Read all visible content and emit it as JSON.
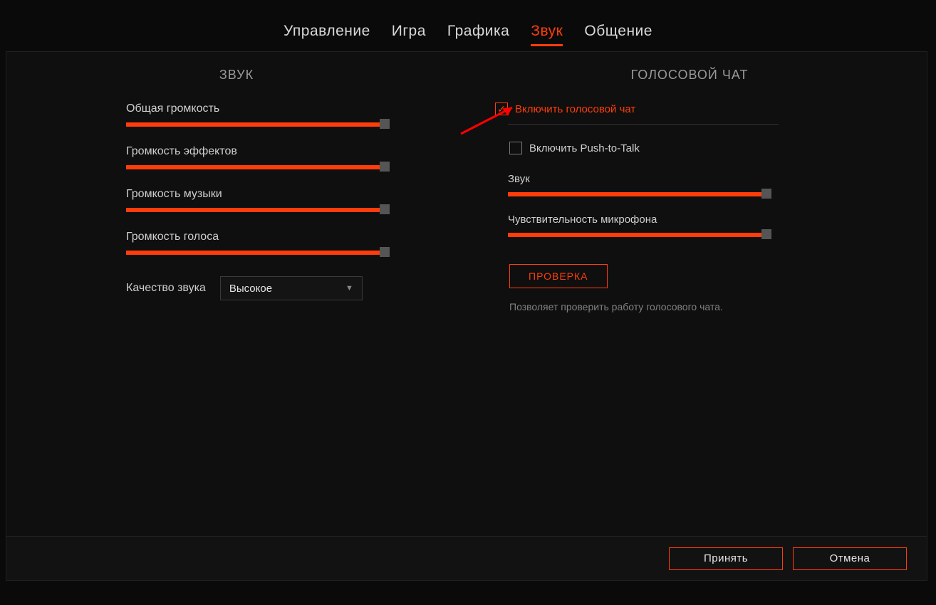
{
  "tabs": {
    "control": "Управление",
    "game": "Игра",
    "graphics": "Графика",
    "sound": "Звук",
    "communication": "Общение"
  },
  "left": {
    "title": "ЗВУК",
    "sliders": {
      "master": {
        "label": "Общая громкость",
        "value": 98
      },
      "effects": {
        "label": "Громкость эффектов",
        "value": 98
      },
      "music": {
        "label": "Громкость музыки",
        "value": 98
      },
      "voice": {
        "label": "Громкость голоса",
        "value": 98
      }
    },
    "quality_label": "Качество звука",
    "quality_value": "Высокое"
  },
  "right": {
    "title": "ГОЛОСОВОЙ ЧАТ",
    "enable_label": "Включить голосовой чат",
    "ptt_label": "Включить Push-tо-Talk",
    "sliders": {
      "sound": {
        "label": "Звук",
        "value": 98
      },
      "sensitivity": {
        "label": "Чувствительность микрофона",
        "value": 98
      }
    },
    "test_button": "ПРОВЕРКА",
    "hint": "Позволяет проверить работу голосового чата."
  },
  "footer": {
    "accept": "Принять",
    "cancel": "Отмена"
  }
}
